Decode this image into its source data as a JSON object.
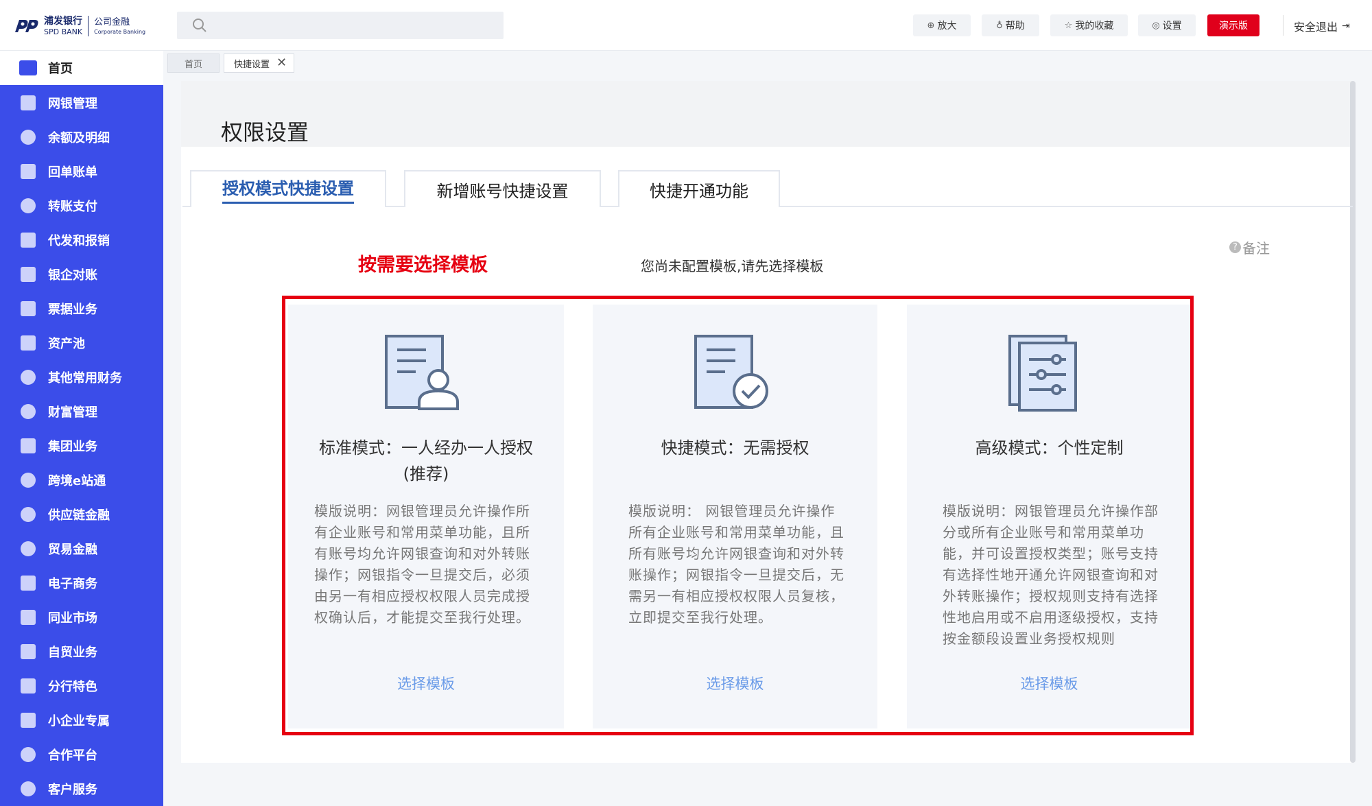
{
  "brand": {
    "bank_cn": "浦发银行",
    "bank_en": "SPD BANK",
    "division_cn": "公司金融",
    "division_en": "Corporate Banking"
  },
  "toolbar": {
    "search_placeholder": "",
    "zoom_label": "放大",
    "help_label": "帮助",
    "favorites_label": "我的收藏",
    "settings_label": "设置",
    "demo_label": "演示版",
    "logout_label": "安全退出"
  },
  "sidebar": {
    "home_label": "首页",
    "items": [
      {
        "label": "网银管理"
      },
      {
        "label": "余额及明细"
      },
      {
        "label": "回单账单"
      },
      {
        "label": "转账支付"
      },
      {
        "label": "代发和报销"
      },
      {
        "label": "银企对账"
      },
      {
        "label": "票据业务"
      },
      {
        "label": "资产池"
      },
      {
        "label": "其他常用财务"
      },
      {
        "label": "财富管理"
      },
      {
        "label": "集团业务"
      },
      {
        "label": "跨境e站通"
      },
      {
        "label": "供应链金融"
      },
      {
        "label": "贸易金融"
      },
      {
        "label": "电子商务"
      },
      {
        "label": "同业市场"
      },
      {
        "label": "自贸业务"
      },
      {
        "label": "分行特色"
      },
      {
        "label": "小企业专属"
      },
      {
        "label": "合作平台"
      },
      {
        "label": "客户服务"
      }
    ]
  },
  "breadcrumbs": {
    "home": "首页",
    "current": "快捷设置",
    "close": "✕"
  },
  "page": {
    "title": "权限设置",
    "tabs": [
      {
        "label": "授权模式快捷设置",
        "active": true
      },
      {
        "label": "新增账号快捷设置",
        "active": false
      },
      {
        "label": "快捷开通功能",
        "active": false
      }
    ],
    "annotation": "按需要选择模板",
    "notice": "您尚未配置模板,请先选择模板",
    "remark": "备注",
    "remark_icon": "?"
  },
  "cards": [
    {
      "icon": "document-user-icon",
      "title_line1": "标准模式：一人经办一人授权",
      "title_line2": "(推荐)",
      "description": "模版说明：网银管理员允许操作所有企业账号和常用菜单功能，且所有账号均允许网银查询和对外转账操作；网银指令一旦提交后，必须由另一有相应授权权限人员完成授权确认后，才能提交至我行处理。",
      "link": "选择模板"
    },
    {
      "icon": "document-check-icon",
      "title_line1": "快捷模式：无需授权",
      "title_line2": "",
      "description": "模版说明： 网银管理员允许操作所有企业账号和常用菜单功能，且所有账号均允许网银查询和对外转账操作；网银指令一旦提交后，无需另一有相应授权权限人员复核，立即提交至我行处理。",
      "link": "选择模板"
    },
    {
      "icon": "document-sliders-icon",
      "title_line1": "高级模式：个性定制",
      "title_line2": "",
      "description": "模版说明：网银管理员允许操作部分或所有企业账号和常用菜单功能，并可设置授权类型；账号支持有选择性地开通允许网银查询和对外转账操作；授权规则支持有选择性地启用或不启用逐级授权，支持按金额段设置业务授权规则",
      "link": "选择模板"
    }
  ],
  "colors": {
    "sidebar_bg": "#3b4de9",
    "accent_blue": "#2a5db0",
    "highlight_red": "#e60012",
    "link_blue": "#6a9be8"
  }
}
